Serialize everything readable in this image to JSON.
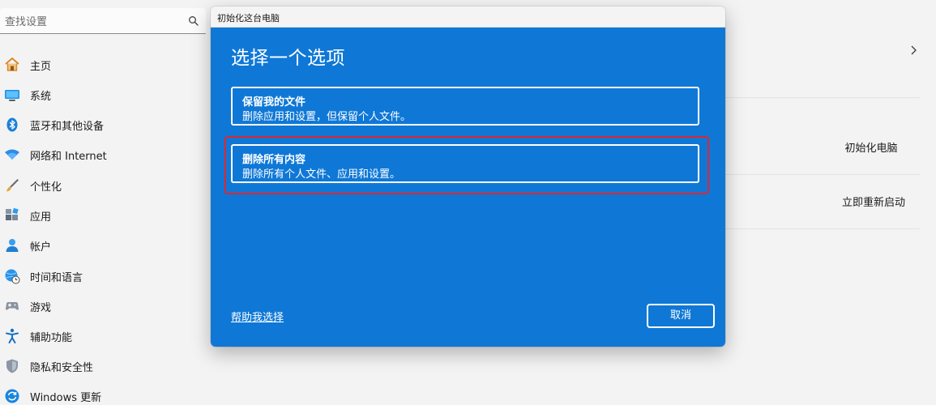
{
  "search": {
    "placeholder": "查找设置"
  },
  "sidebar": {
    "items": [
      {
        "label": "主页"
      },
      {
        "label": "系统"
      },
      {
        "label": "蓝牙和其他设备"
      },
      {
        "label": "网络和 Internet"
      },
      {
        "label": "个性化"
      },
      {
        "label": "应用"
      },
      {
        "label": "帐户"
      },
      {
        "label": "时间和语言"
      },
      {
        "label": "游戏"
      },
      {
        "label": "辅助功能"
      },
      {
        "label": "隐私和安全性"
      },
      {
        "label": "Windows 更新"
      }
    ]
  },
  "right_panel": {
    "reset_pc_label": "初始化电脑",
    "restart_now_label": "立即重新启动"
  },
  "dialog": {
    "title": "初始化这台电脑",
    "heading": "选择一个选项",
    "options": [
      {
        "title": "保留我的文件",
        "desc": "删除应用和设置，但保留个人文件。"
      },
      {
        "title": "删除所有内容",
        "desc": "删除所有个人文件、应用和设置。"
      }
    ],
    "help_link": "帮助我选择",
    "cancel_label": "取消"
  },
  "colors": {
    "dialog_blue": "#0f78d6",
    "highlight_red": "#e0262e",
    "page_background": "#f3f3f3"
  }
}
